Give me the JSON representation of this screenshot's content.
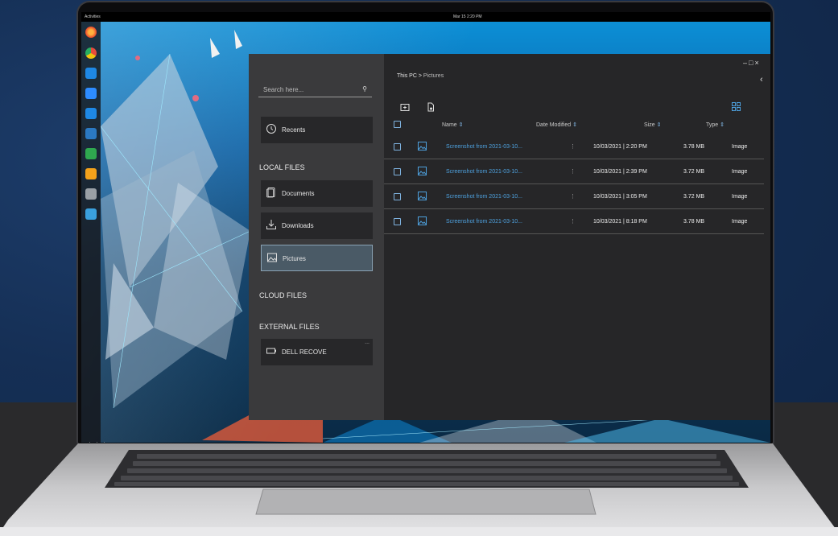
{
  "colors": {
    "accent": "#4ea1de",
    "sidebar": "#3a3a3c",
    "main": "#262628",
    "selected": "#4a5a66"
  },
  "topbar": {
    "activities": "Activities",
    "clock": "Mar 15  2:20 PM"
  },
  "dock": {
    "icons": [
      "firefox-icon",
      "chrome-icon",
      "email-client-icon",
      "zoom-icon",
      "home-icon",
      "document-icon",
      "spreadsheet-icon",
      "presentation-icon",
      "mail-icon",
      "photos-icon"
    ]
  },
  "sidebar": {
    "search_placeholder": "Search here...",
    "recents": "Recents",
    "local_files": "LOCAL FILES",
    "documents": "Documents",
    "downloads": "Downloads",
    "pictures": "Pictures",
    "cloud_files": "CLOUD FILES",
    "external_files": "EXTERNAL FILES",
    "drive": "DELL RECOVE",
    "drive_more": "..."
  },
  "main": {
    "breadcrumb_root": "This PC",
    "breadcrumb_sep": ">",
    "breadcrumb_current": "Pictures",
    "columns": {
      "name": "Name",
      "date": "Date Modified",
      "size": "Size",
      "type": "Type"
    },
    "sort_icon": "⇕",
    "rows": [
      {
        "name": "Screenshot from 2021-03-10...",
        "date": "10/03/2021 | 2:20 PM",
        "size": "3.78 MB",
        "type": "Image"
      },
      {
        "name": "Screenshot from 2021-03-10...",
        "date": "10/03/2021 | 2:39 PM",
        "size": "3.72 MB",
        "type": "Image"
      },
      {
        "name": "Screenshot from 2021-03-10...",
        "date": "10/03/2021 | 3:05 PM",
        "size": "3.72 MB",
        "type": "Image"
      },
      {
        "name": "Screenshot from 2021-03-10...",
        "date": "10/03/2021 | 8:18 PM",
        "size": "3.78 MB",
        "type": "Image"
      }
    ],
    "kebab": "⋮"
  },
  "window": {
    "minimize": "–",
    "maximize": "□",
    "close": "×",
    "back": "‹"
  }
}
